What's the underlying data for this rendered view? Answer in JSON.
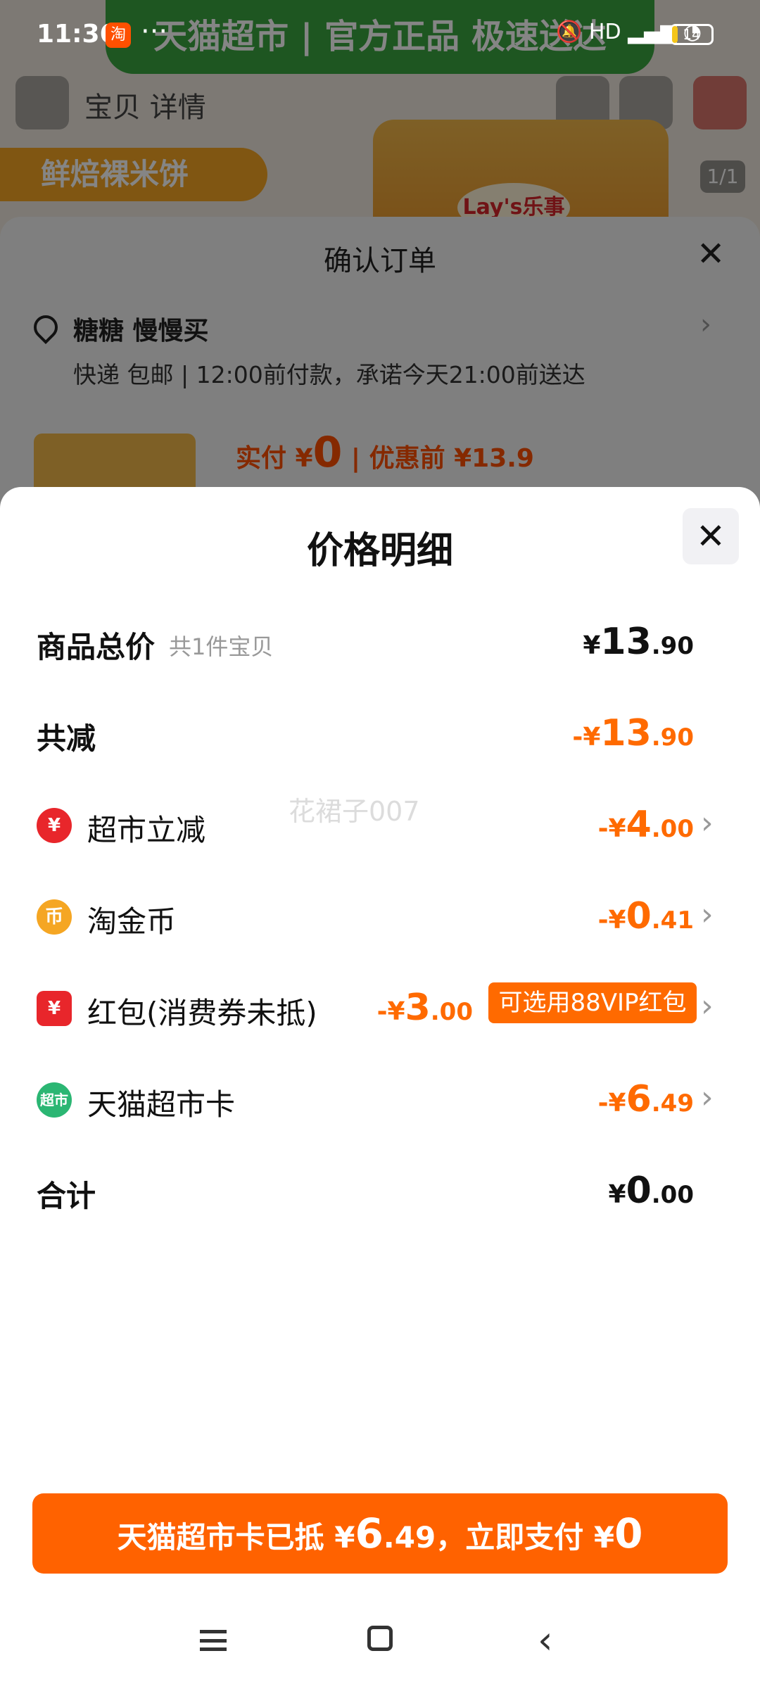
{
  "status_bar": {
    "time": "11:36",
    "dots": "···",
    "battery": "14",
    "signal": "HD",
    "app_icon": "淘"
  },
  "background_page": {
    "banner": "天猫超市 | 官方正品 极速送达",
    "nav_title": "宝贝 详情",
    "product_tag": "鲜焙裸米饼",
    "bag_label": "Lay's乐事",
    "page_counter": "1/1"
  },
  "order_sheet": {
    "title": "确认订单",
    "recipient": "糖糖 慢慢买",
    "delivery": "快递 包邮 | 12:00前付款，承诺今天21:00前送达",
    "paid_prefix": "实付 ¥",
    "paid_amount": "0",
    "before_discount": "| 优惠前 ¥13.9"
  },
  "detail_sheet": {
    "title": "价格明细",
    "close_label": "✕",
    "watermark": "花裙子007",
    "rows": [
      {
        "label": "商品总价",
        "sub": "共1件宝贝",
        "cur": "¥",
        "int": "13",
        "dec": ".90"
      },
      {
        "label": "共减",
        "cur": "-¥",
        "int": "13",
        "dec": ".90"
      },
      {
        "label": "超市立减",
        "icon": "¥",
        "cur": "-¥",
        "int": "4",
        "dec": ".00"
      },
      {
        "label": "淘金币",
        "icon": "币",
        "cur": "-¥",
        "int": "0",
        "dec": ".41"
      },
      {
        "label": "红包(消费券未抵)",
        "icon": "¥",
        "cur": "-¥",
        "int": "3",
        "dec": ".00",
        "badge": "可选用88VIP红包"
      },
      {
        "label": "天猫超市卡",
        "icon": "超市",
        "cur": "-¥",
        "int": "6",
        "dec": ".49"
      },
      {
        "label": "合计",
        "cur": "¥",
        "int": "0",
        "dec": ".00"
      }
    ],
    "pay_button": {
      "text1": "天猫超市卡已抵 ¥",
      "num1": "6",
      "dec1": ".49",
      "text2": "，立即支付 ¥",
      "num2": "0"
    }
  },
  "colors": {
    "accent": "#ff6200",
    "discount": "#ff6a00",
    "coupon_red": "#e8262b",
    "coin_yellow": "#f5a623",
    "card_green": "#2bb673"
  },
  "icons": [
    "location-pin-icon",
    "chevron-right-icon",
    "close-icon",
    "supermarket-discount-icon",
    "gold-coin-icon",
    "red-packet-icon",
    "tmall-card-icon",
    "menu-icon",
    "home-icon",
    "back-icon"
  ]
}
